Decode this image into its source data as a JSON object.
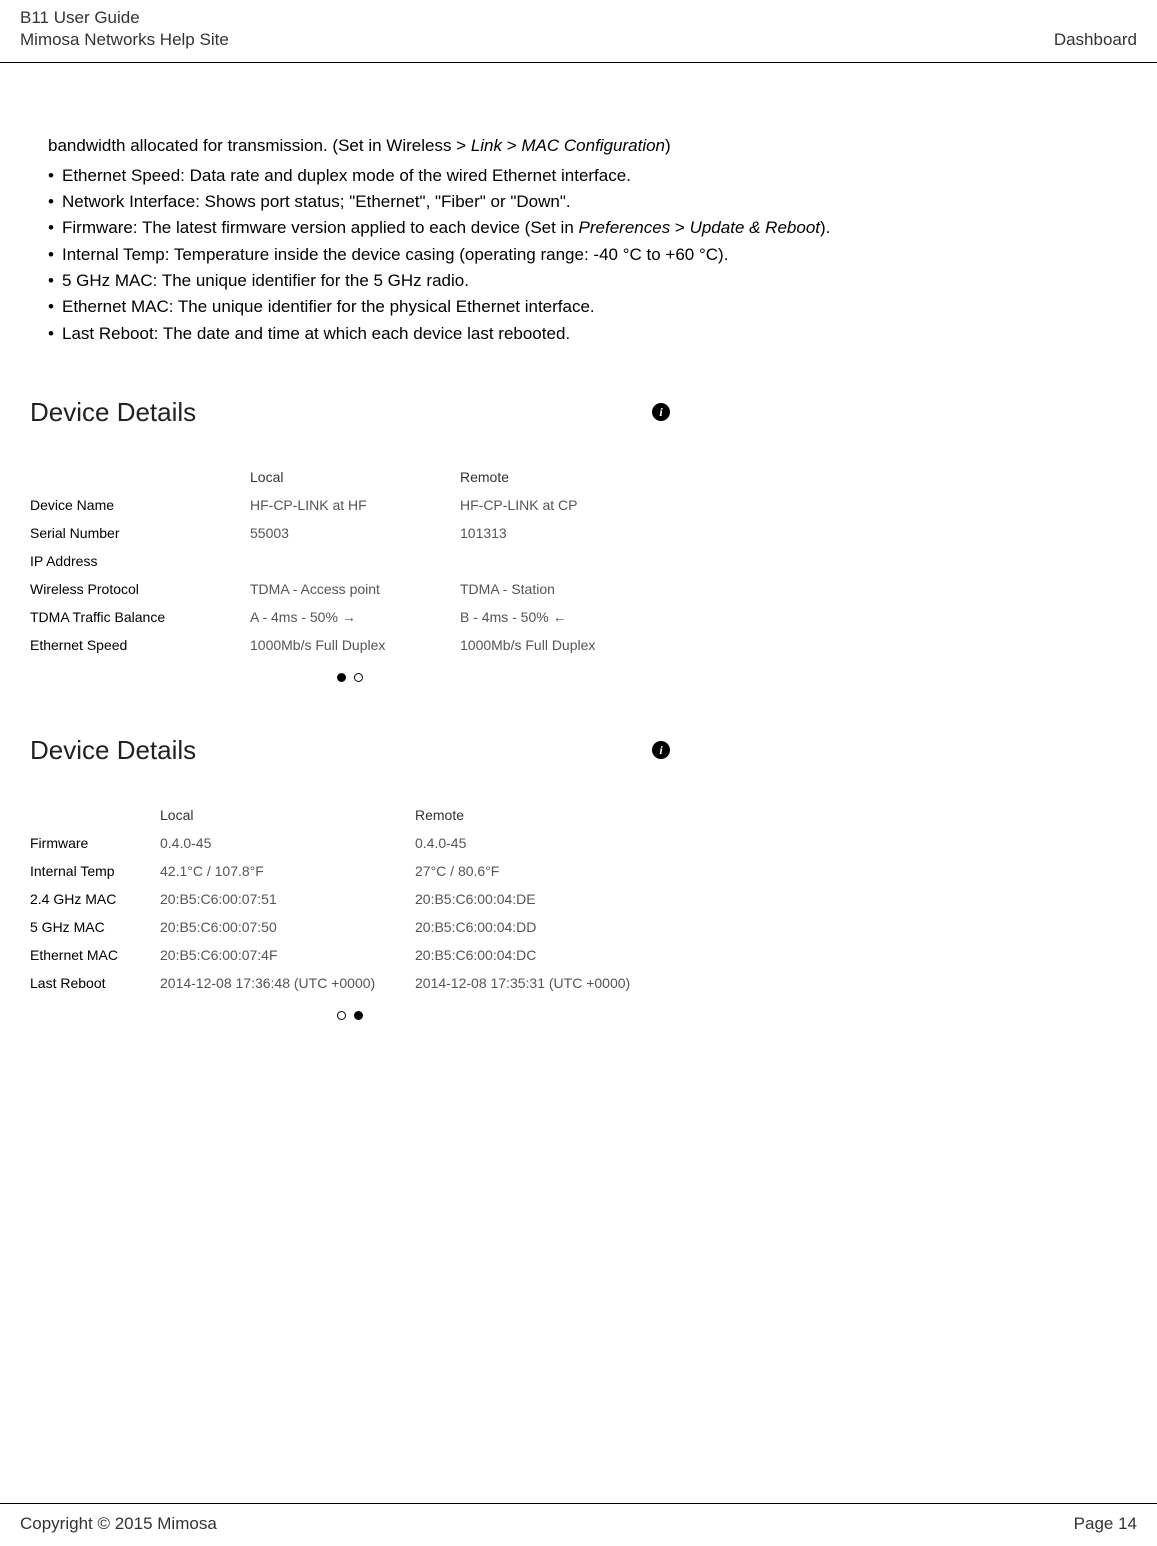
{
  "header": {
    "title1": "B11 User Guide",
    "title2": "Mimosa Networks Help Site",
    "section": "Dashboard"
  },
  "intro": {
    "line1_pre": "bandwidth allocated for transmission. (Set in Wireless > ",
    "line1_it1": "Link",
    "line1_mid": " > ",
    "line1_it2": "MAC Configuration",
    "line1_post": ")"
  },
  "bullets": [
    {
      "pre": "Ethernet Speed: Data rate and duplex mode of the wired Ethernet interface.",
      "it1": "",
      "mid": "",
      "it2": "",
      "post": ""
    },
    {
      "pre": "Network Interface: Shows port status; \"Ethernet\", \"Fiber\" or \"Down\".",
      "it1": "",
      "mid": "",
      "it2": "",
      "post": ""
    },
    {
      "pre": "Firmware: The latest firmware version applied to each device (Set in ",
      "it1": "Preferences",
      "mid": " > ",
      "it2": "Update & Reboot",
      "post": ")."
    },
    {
      "pre": "Internal Temp: Temperature inside the device casing  (operating range: -40 °C to +60 °C).",
      "it1": "",
      "mid": "",
      "it2": "",
      "post": ""
    },
    {
      "pre": "5 GHz MAC: The unique identifier for the 5 GHz radio.",
      "it1": "",
      "mid": "",
      "it2": "",
      "post": ""
    },
    {
      "pre": "Ethernet MAC: The unique identifier for the physical Ethernet interface.",
      "it1": "",
      "mid": "",
      "it2": "",
      "post": ""
    },
    {
      "pre": "Last Reboot:  The date and time at which each device last rebooted.",
      "it1": "",
      "mid": "",
      "it2": "",
      "post": ""
    }
  ],
  "panel1": {
    "title": "Device Details",
    "cols": [
      "",
      "Local",
      "Remote"
    ],
    "rows": [
      {
        "label": "Device Name",
        "local": "HF-CP-LINK at HF",
        "remote": "HF-CP-LINK at CP"
      },
      {
        "label": "Serial Number",
        "local": "55003",
        "remote": "101313"
      },
      {
        "label": "IP Address",
        "local": "",
        "remote": ""
      },
      {
        "label": "Wireless Protocol",
        "local": "TDMA - Access point",
        "remote": "TDMA - Station"
      },
      {
        "label": "TDMA Traffic Balance",
        "local": "A - 4ms - 50%",
        "local_arrow": "→",
        "remote": "B - 4ms - 50%",
        "remote_arrow": "←"
      },
      {
        "label": "Ethernet Speed",
        "local": "1000Mb/s Full Duplex",
        "remote": "1000Mb/s Full Duplex"
      }
    ]
  },
  "panel2": {
    "title": "Device Details",
    "cols": [
      "",
      "Local",
      "Remote"
    ],
    "rows": [
      {
        "label": "Firmware",
        "local": "0.4.0-45",
        "remote": "0.4.0-45"
      },
      {
        "label": "Internal Temp",
        "local": "42.1°C / 107.8°F",
        "remote": "27°C / 80.6°F"
      },
      {
        "label": "2.4 GHz MAC",
        "local": "20:B5:C6:00:07:51",
        "remote": "20:B5:C6:00:04:DE"
      },
      {
        "label": "5 GHz MAC",
        "local": "20:B5:C6:00:07:50",
        "remote": "20:B5:C6:00:04:DD"
      },
      {
        "label": "Ethernet MAC",
        "local": "20:B5:C6:00:07:4F",
        "remote": "20:B5:C6:00:04:DC"
      },
      {
        "label": "Last Reboot",
        "local": "2014-12-08 17:36:48 (UTC +0000)",
        "remote": "2014-12-08 17:35:31 (UTC +0000)"
      }
    ]
  },
  "footer": {
    "copyright": "Copyright © 2015 Mimosa",
    "page": "Page 14"
  }
}
